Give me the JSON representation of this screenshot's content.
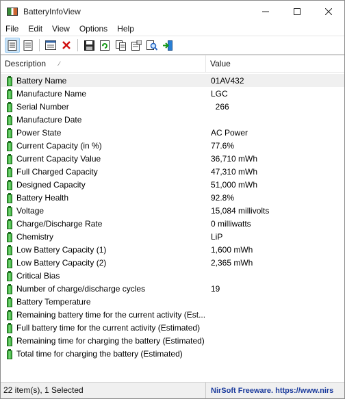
{
  "window": {
    "title": "BatteryInfoView"
  },
  "menu": [
    "File",
    "Edit",
    "View",
    "Options",
    "Help"
  ],
  "columns": {
    "description": "Description",
    "value": "Value"
  },
  "rows": [
    {
      "description": "Battery Name",
      "value": "01AV432",
      "selected": true
    },
    {
      "description": "Manufacture Name",
      "value": "LGC"
    },
    {
      "description": "Serial Number",
      "value": "  266"
    },
    {
      "description": "Manufacture Date",
      "value": ""
    },
    {
      "description": "Power State",
      "value": "AC Power"
    },
    {
      "description": "Current Capacity (in %)",
      "value": "77.6%"
    },
    {
      "description": "Current Capacity Value",
      "value": "36,710 mWh"
    },
    {
      "description": "Full Charged Capacity",
      "value": "47,310 mWh"
    },
    {
      "description": "Designed Capacity",
      "value": "51,000 mWh"
    },
    {
      "description": "Battery Health",
      "value": "92.8%"
    },
    {
      "description": "Voltage",
      "value": "15,084 millivolts"
    },
    {
      "description": "Charge/Discharge Rate",
      "value": "0 milliwatts"
    },
    {
      "description": "Chemistry",
      "value": "LiP"
    },
    {
      "description": "Low Battery Capacity (1)",
      "value": "1,600 mWh"
    },
    {
      "description": "Low Battery Capacity (2)",
      "value": "2,365 mWh"
    },
    {
      "description": "Critical Bias",
      "value": ""
    },
    {
      "description": "Number of charge/discharge cycles",
      "value": "19"
    },
    {
      "description": "Battery Temperature",
      "value": ""
    },
    {
      "description": "Remaining battery time for the current activity (Est...",
      "value": ""
    },
    {
      "description": "Full battery time for the current activity (Estimated)",
      "value": ""
    },
    {
      "description": "Remaining time for charging the battery (Estimated)",
      "value": ""
    },
    {
      "description": "Total  time for charging the battery (Estimated)",
      "value": ""
    }
  ],
  "status": {
    "items": "22 item(s), 1 Selected",
    "credit": "NirSoft Freeware. https://www.nirs"
  }
}
